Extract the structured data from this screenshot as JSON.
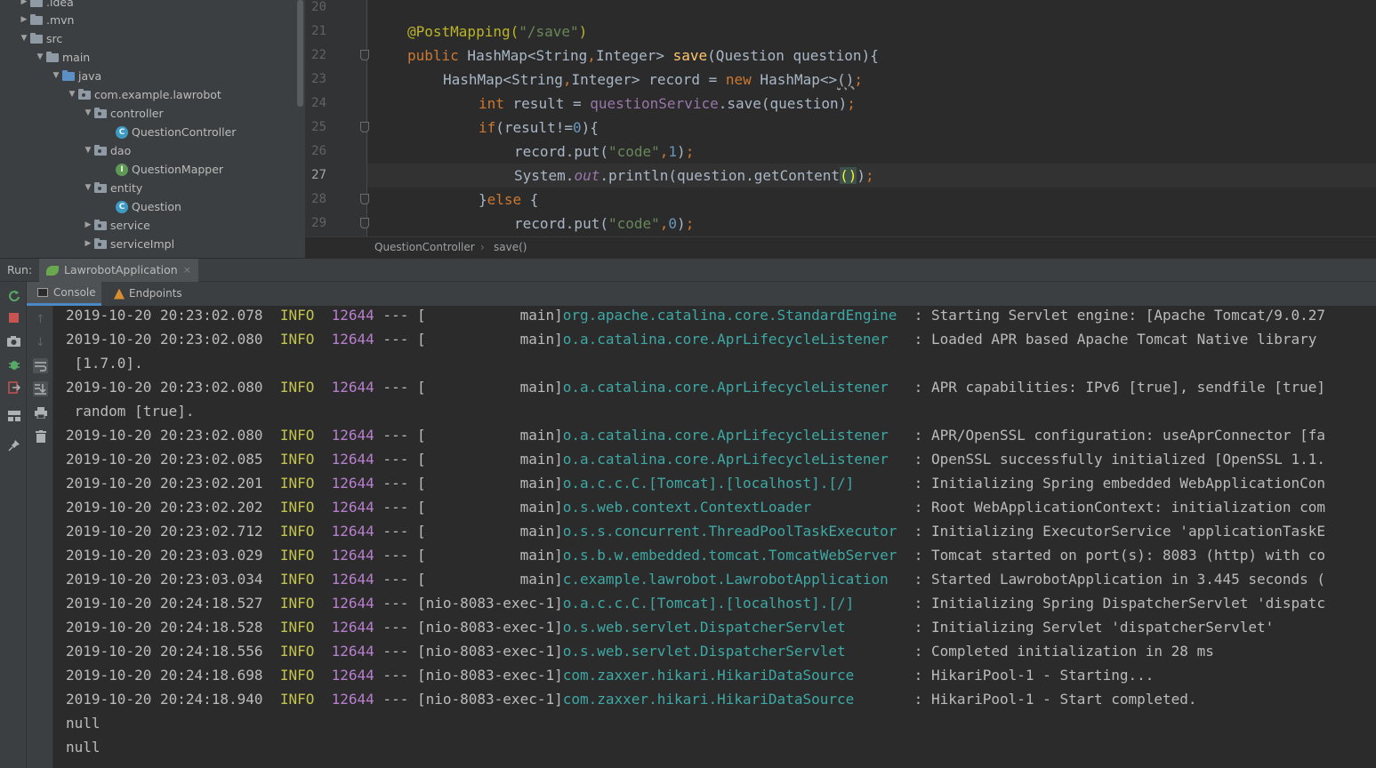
{
  "project_tree": {
    "items": [
      {
        "label": ".idea",
        "type": "folder",
        "arrow": "▶"
      },
      {
        "label": ".mvn",
        "type": "folder",
        "arrow": "▶"
      },
      {
        "label": "src",
        "type": "folder",
        "arrow": "▼"
      },
      {
        "label": "main",
        "type": "folder",
        "arrow": "▼"
      },
      {
        "label": "java",
        "type": "source-folder",
        "arrow": "▼"
      },
      {
        "label": "com.example.lawrobot",
        "type": "package",
        "arrow": "▼"
      },
      {
        "label": "controller",
        "type": "package",
        "arrow": "▼"
      },
      {
        "label": "QuestionController",
        "type": "class",
        "arrow": ""
      },
      {
        "label": "dao",
        "type": "package",
        "arrow": "▼"
      },
      {
        "label": "QuestionMapper",
        "type": "interface",
        "arrow": ""
      },
      {
        "label": "entity",
        "type": "package",
        "arrow": "▼"
      },
      {
        "label": "Question",
        "type": "class",
        "arrow": ""
      },
      {
        "label": "service",
        "type": "package",
        "arrow": "▶"
      },
      {
        "label": "serviceImpl",
        "type": "package",
        "arrow": "▶"
      }
    ]
  },
  "editor": {
    "line_numbers": [
      "20",
      "21",
      "22",
      "23",
      "24",
      "25",
      "26",
      "27",
      "28",
      "29"
    ],
    "current_line": "27",
    "code": {
      "l21_ann": "@PostMapping(",
      "l21_str": "\"/save\"",
      "l21_end": ")",
      "l22_kw": "public",
      "l22_type": " HashMap<String",
      "l22_comma": ",",
      "l22_type2": "Integer> ",
      "l22_fn": "save",
      "l22_rest": "(Question question){",
      "l23_type": "HashMap<String",
      "l23_comma": ",",
      "l23_type2": "Integer> record = ",
      "l23_kw": "new",
      "l23_rest": " HashMap<>",
      "l23_paren": "()",
      "l23_semi": ";",
      "l24_kw": "int",
      "l24_mid": " result = ",
      "l24_fld": "questionService",
      "l24_rest": ".save(question)",
      "l24_semi": ";",
      "l25_kw": "if",
      "l25_a": "(result!=",
      "l25_num": "0",
      "l25_b": "){",
      "l26_a": "record.put(",
      "l26_str": "\"code\"",
      "l26_comma": ",",
      "l26_num": "1",
      "l26_b": ")",
      "l26_semi": ";",
      "l27_a": "System.",
      "l27_static": "out",
      "l27_b": ".println(question.getContent",
      "l27_brace": "()",
      "l27_c": ")",
      "l27_semi": ";",
      "l28_a": "}",
      "l28_kw": "else",
      "l28_b": " {",
      "l29_a": "record.put(",
      "l29_str": "\"code\"",
      "l29_comma": ",",
      "l29_num": "0",
      "l29_b": ")",
      "l29_semi": ";"
    }
  },
  "breadcrumb": {
    "class": "QuestionController",
    "separator": "›",
    "method": "save()"
  },
  "run_panel": {
    "label": "Run:",
    "tab": "LawrobotApplication",
    "close": "×",
    "sub_tabs": {
      "console": "Console",
      "endpoints": "Endpoints"
    }
  },
  "console": {
    "lines": [
      {
        "ts": "2019-10-20 20:23:02.078",
        "level": "INFO",
        "pid": "12644",
        "sep": " --- ",
        "thread": "[           main]",
        "logger": "org.apache.catalina.core.StandardEngine",
        "msg": "  : Starting Servlet engine: [Apache Tomcat/9.0.27"
      },
      {
        "ts": "2019-10-20 20:23:02.080",
        "level": "INFO",
        "pid": "12644",
        "sep": " --- ",
        "thread": "[           main]",
        "logger": "o.a.catalina.core.AprLifecycleListener",
        "msg": "   : Loaded APR based Apache Tomcat Native library"
      },
      {
        "cont": " [1.7.0]."
      },
      {
        "ts": "2019-10-20 20:23:02.080",
        "level": "INFO",
        "pid": "12644",
        "sep": " --- ",
        "thread": "[           main]",
        "logger": "o.a.catalina.core.AprLifecycleListener",
        "msg": "   : APR capabilities: IPv6 [true], sendfile [true]"
      },
      {
        "cont": " random [true]."
      },
      {
        "ts": "2019-10-20 20:23:02.080",
        "level": "INFO",
        "pid": "12644",
        "sep": " --- ",
        "thread": "[           main]",
        "logger": "o.a.catalina.core.AprLifecycleListener",
        "msg": "   : APR/OpenSSL configuration: useAprConnector [fa"
      },
      {
        "ts": "2019-10-20 20:23:02.085",
        "level": "INFO",
        "pid": "12644",
        "sep": " --- ",
        "thread": "[           main]",
        "logger": "o.a.catalina.core.AprLifecycleListener",
        "msg": "   : OpenSSL successfully initialized [OpenSSL 1.1."
      },
      {
        "ts": "2019-10-20 20:23:02.201",
        "level": "INFO",
        "pid": "12644",
        "sep": " --- ",
        "thread": "[           main]",
        "logger": "o.a.c.c.C.[Tomcat].[localhost].[/]",
        "msg": "       : Initializing Spring embedded WebApplicationCon"
      },
      {
        "ts": "2019-10-20 20:23:02.202",
        "level": "INFO",
        "pid": "12644",
        "sep": " --- ",
        "thread": "[           main]",
        "logger": "o.s.web.context.ContextLoader",
        "msg": "            : Root WebApplicationContext: initialization com"
      },
      {
        "ts": "2019-10-20 20:23:02.712",
        "level": "INFO",
        "pid": "12644",
        "sep": " --- ",
        "thread": "[           main]",
        "logger": "o.s.s.concurrent.ThreadPoolTaskExecutor",
        "msg": "  : Initializing ExecutorService 'applicationTaskE"
      },
      {
        "ts": "2019-10-20 20:23:03.029",
        "level": "INFO",
        "pid": "12644",
        "sep": " --- ",
        "thread": "[           main]",
        "logger": "o.s.b.w.embedded.tomcat.TomcatWebServer",
        "msg": "  : Tomcat started on port(s): 8083 (http) with co"
      },
      {
        "ts": "2019-10-20 20:23:03.034",
        "level": "INFO",
        "pid": "12644",
        "sep": " --- ",
        "thread": "[           main]",
        "logger": "c.example.lawrobot.LawrobotApplication",
        "msg": "   : Started LawrobotApplication in 3.445 seconds ("
      },
      {
        "ts": "2019-10-20 20:24:18.527",
        "level": "INFO",
        "pid": "12644",
        "sep": " --- ",
        "thread": "[nio-8083-exec-1]",
        "logger": "o.a.c.c.C.[Tomcat].[localhost].[/]",
        "msg": "       : Initializing Spring DispatcherServlet 'dispatc"
      },
      {
        "ts": "2019-10-20 20:24:18.528",
        "level": "INFO",
        "pid": "12644",
        "sep": " --- ",
        "thread": "[nio-8083-exec-1]",
        "logger": "o.s.web.servlet.DispatcherServlet",
        "msg": "        : Initializing Servlet 'dispatcherServlet'"
      },
      {
        "ts": "2019-10-20 20:24:18.556",
        "level": "INFO",
        "pid": "12644",
        "sep": " --- ",
        "thread": "[nio-8083-exec-1]",
        "logger": "o.s.web.servlet.DispatcherServlet",
        "msg": "        : Completed initialization in 28 ms"
      },
      {
        "ts": "2019-10-20 20:24:18.698",
        "level": "INFO",
        "pid": "12644",
        "sep": " --- ",
        "thread": "[nio-8083-exec-1]",
        "logger": "com.zaxxer.hikari.HikariDataSource",
        "msg": "       : HikariPool-1 - Starting..."
      },
      {
        "ts": "2019-10-20 20:24:18.940",
        "level": "INFO",
        "pid": "12644",
        "sep": " --- ",
        "thread": "[nio-8083-exec-1]",
        "logger": "com.zaxxer.hikari.HikariDataSource",
        "msg": "       : HikariPool-1 - Start completed."
      },
      {
        "cont": "null"
      },
      {
        "cont": "null"
      }
    ]
  },
  "toolbar_icons": {
    "rerun": "rerun-icon",
    "stop": "stop-icon",
    "camera": "camera-icon",
    "debug": "debug-icon",
    "exit": "exit-icon",
    "layout": "layout-icon",
    "pin": "pin-icon",
    "up": "arrow-up-icon",
    "down": "arrow-down-icon",
    "wrap": "soft-wrap-icon",
    "scroll_end": "scroll-to-end-icon",
    "print": "print-icon",
    "trash": "trash-icon"
  },
  "colors": {
    "accent": "#4a88c7",
    "info": "#c3c44d",
    "pid": "#b97fcf",
    "logger": "#3ea8a5"
  }
}
